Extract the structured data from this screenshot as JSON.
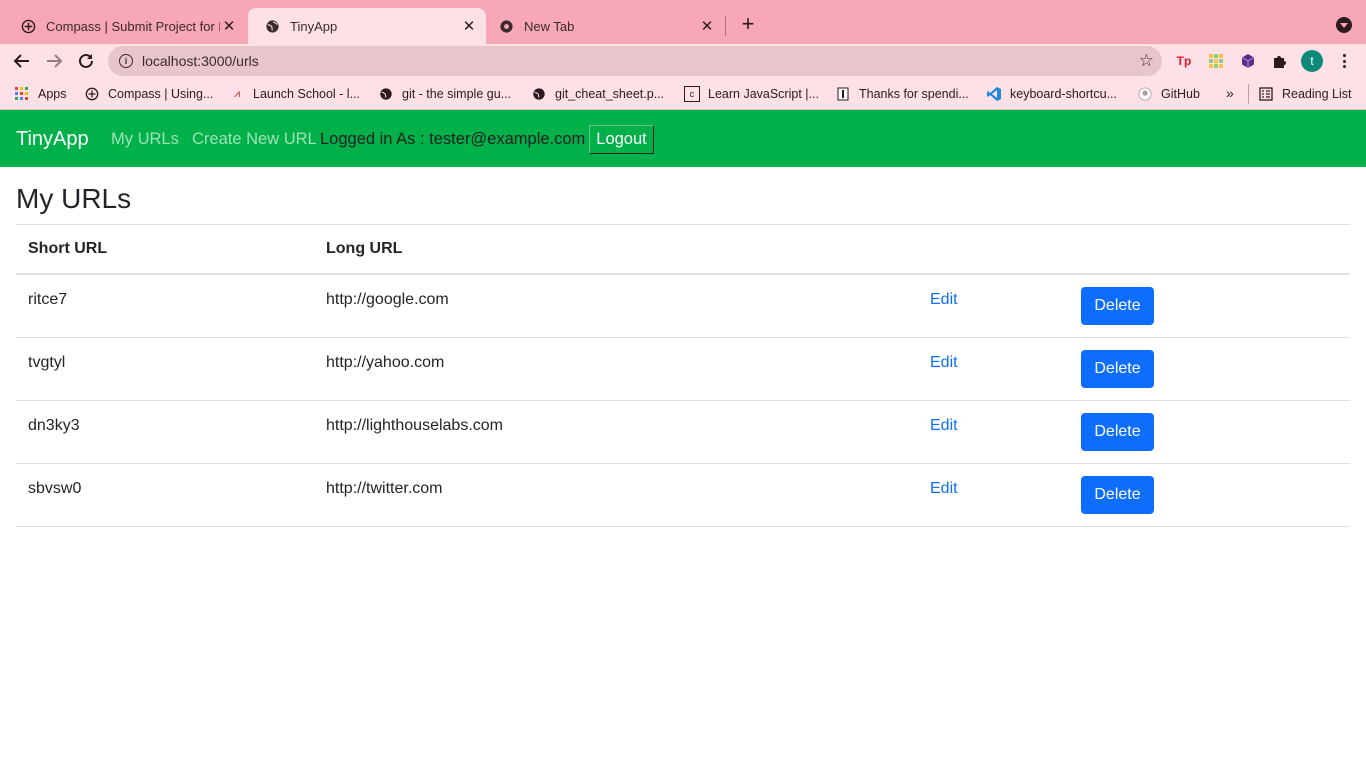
{
  "browser": {
    "tabs": [
      {
        "title": "Compass | Submit Project for E",
        "favicon": "compass-icon",
        "active": false
      },
      {
        "title": "TinyApp",
        "favicon": "globe-icon",
        "active": true
      },
      {
        "title": "New Tab",
        "favicon": "chrome-icon",
        "active": false
      }
    ],
    "new_tab": "+",
    "url": "localhost:3000/urls",
    "avatar_initial": "t",
    "extensions": [
      "Tp",
      "grid-extension-icon",
      "cube-extension-icon",
      "puzzle-icon"
    ],
    "bookmarks": [
      {
        "label": "Apps",
        "icon": "apps-grid-icon"
      },
      {
        "label": "Compass | Using...",
        "icon": "compass-icon"
      },
      {
        "label": "Launch School - l...",
        "icon": "launch-school-icon"
      },
      {
        "label": "git - the simple gu...",
        "icon": "globe-icon"
      },
      {
        "label": "git_cheat_sheet.p...",
        "icon": "globe-icon"
      },
      {
        "label": "Learn JavaScript |...",
        "icon": "codecademy-icon"
      },
      {
        "label": "Thanks for spendi...",
        "icon": "page-icon"
      },
      {
        "label": "keyboard-shortcu...",
        "icon": "vscode-icon"
      },
      {
        "label": "GitHub",
        "icon": "github-icon"
      }
    ],
    "bookmarks_overflow": "»",
    "reading_list": "Reading List",
    "theme_colors": {
      "tabbar": "#f7a7b7",
      "toolbar": "#fde1e6"
    }
  },
  "app": {
    "brand": "TinyApp",
    "nav": {
      "my_urls": "My URLs",
      "create_new": "Create New URL"
    },
    "login_text": "Logged in As : tester@example.com",
    "logout_label": "Logout",
    "nav_color": "#00b14a"
  },
  "main": {
    "title": "My URLs",
    "table": {
      "headers": [
        "Short URL",
        "Long URL",
        "",
        ""
      ],
      "rows": [
        {
          "short": "ritce7",
          "long": "http://google.com",
          "edit": "Edit",
          "delete": "Delete"
        },
        {
          "short": "tvgtyl",
          "long": "http://yahoo.com",
          "edit": "Edit",
          "delete": "Delete"
        },
        {
          "short": "dn3ky3",
          "long": "http://lighthouselabs.com",
          "edit": "Edit",
          "delete": "Delete"
        },
        {
          "short": "sbvsw0",
          "long": "http://twitter.com",
          "edit": "Edit",
          "delete": "Delete"
        }
      ]
    },
    "button_color": "#0d6efd"
  }
}
